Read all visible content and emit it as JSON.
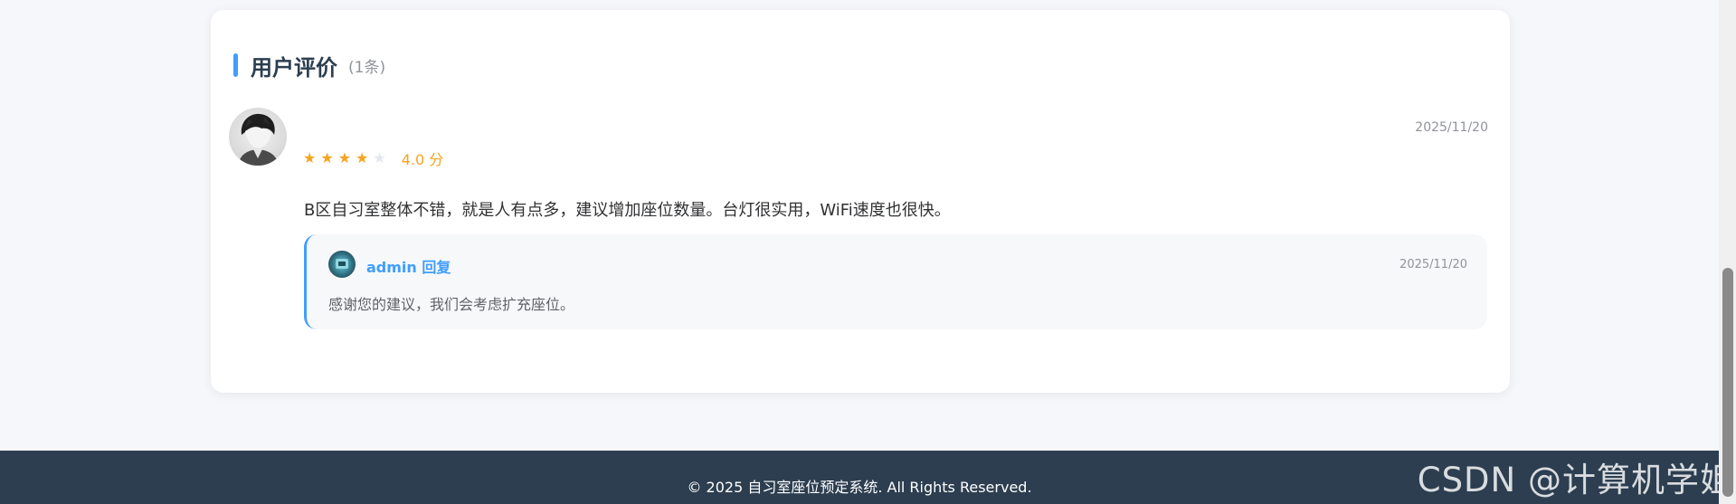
{
  "reviews_section": {
    "title": "用户评价",
    "count": "(1条)"
  },
  "review": {
    "stars": [
      1,
      1,
      1,
      1,
      0
    ],
    "star_glyph": "★",
    "rating_text": "4.0 分",
    "rating_value": 4.0,
    "date": "2025/11/20",
    "content": "B区自习室整体不错，就是人有点多，建议增加座位数量。台灯很实用，WiFi速度也很快。"
  },
  "reply": {
    "author": "admin 回复",
    "date": "2025/11/20",
    "content": "感谢您的建议，我们会考虑扩充座位。"
  },
  "footer": {
    "copyright": "© 2025 自习室座位预定系统. All Rights Reserved."
  },
  "watermark": "CSDN @计算机学姐",
  "colors": {
    "accent": "#409eff",
    "star": "#f7a31e",
    "footer_bg": "#2c3e50"
  }
}
